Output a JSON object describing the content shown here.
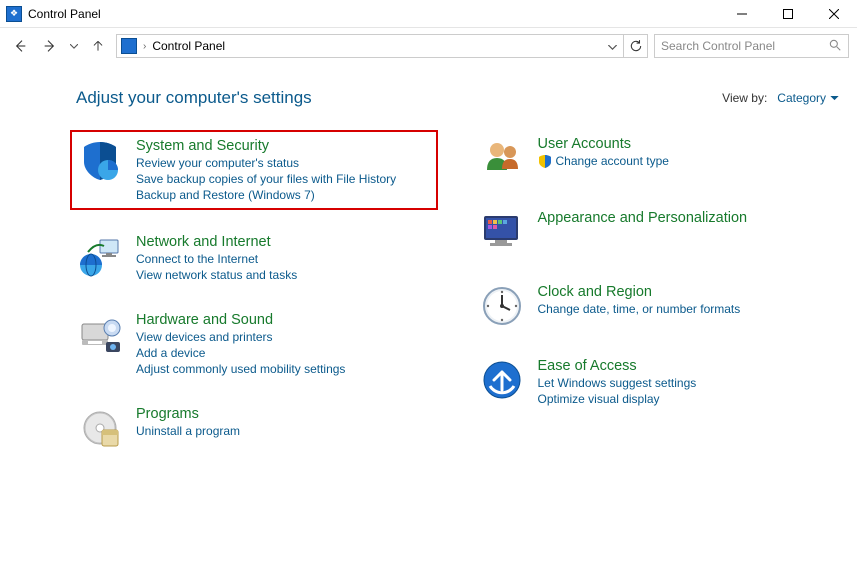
{
  "window": {
    "title": "Control Panel"
  },
  "address": {
    "crumb": "Control Panel"
  },
  "search": {
    "placeholder": "Search Control Panel"
  },
  "header": {
    "title": "Adjust your computer's settings",
    "view_by_label": "View by:",
    "view_by_value": "Category"
  },
  "left_categories": [
    {
      "title": "System and Security",
      "links": [
        "Review your computer's status",
        "Save backup copies of your files with File History",
        "Backup and Restore (Windows 7)"
      ],
      "highlighted": true,
      "icon": "shield"
    },
    {
      "title": "Network and Internet",
      "links": [
        "Connect to the Internet",
        "View network status and tasks"
      ],
      "icon": "network"
    },
    {
      "title": "Hardware and Sound",
      "links": [
        "View devices and printers",
        "Add a device",
        "Adjust commonly used mobility settings"
      ],
      "icon": "hardware"
    },
    {
      "title": "Programs",
      "links": [
        "Uninstall a program"
      ],
      "icon": "programs"
    }
  ],
  "right_categories": [
    {
      "title": "User Accounts",
      "links": [
        {
          "text": "Change account type",
          "shield": true
        }
      ],
      "icon": "users"
    },
    {
      "title": "Appearance and Personalization",
      "links": [],
      "icon": "appearance"
    },
    {
      "title": "Clock and Region",
      "links": [
        "Change date, time, or number formats"
      ],
      "icon": "clock"
    },
    {
      "title": "Ease of Access",
      "links": [
        "Let Windows suggest settings",
        "Optimize visual display"
      ],
      "icon": "ease"
    }
  ]
}
